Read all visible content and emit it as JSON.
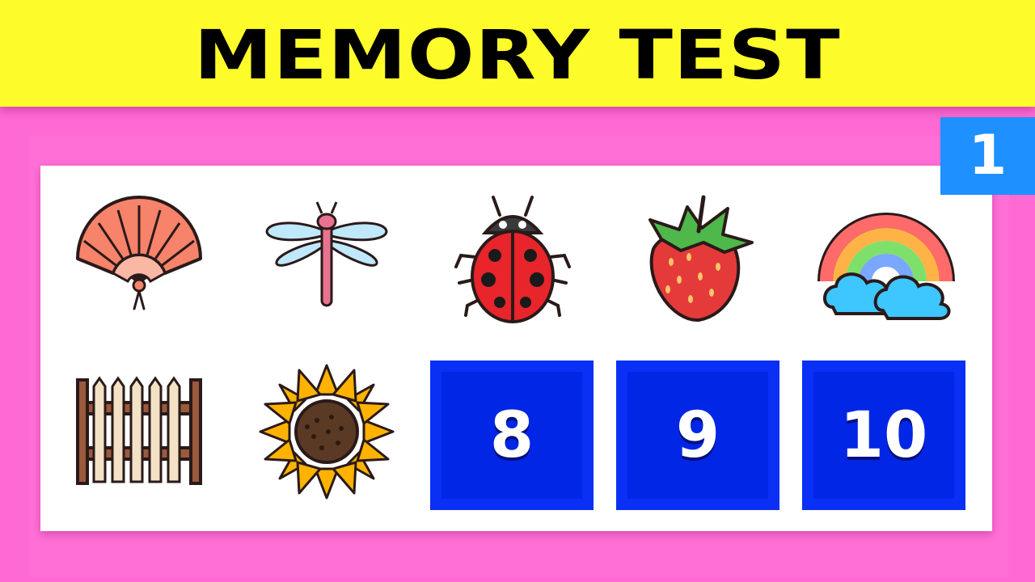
{
  "banner": {
    "title": "MEMORY TEST"
  },
  "level": {
    "number": "1"
  },
  "colors": {
    "background": "#ff69d4",
    "banner": "#fdfb2a",
    "tile": "#0a2ff5",
    "badge": "#1e90ff"
  },
  "cards": [
    {
      "position": 1,
      "icon": "hand-fan-icon"
    },
    {
      "position": 2,
      "icon": "dragonfly-icon"
    },
    {
      "position": 3,
      "icon": "ladybug-icon"
    },
    {
      "position": 4,
      "icon": "strawberry-icon"
    },
    {
      "position": 5,
      "icon": "rainbow-cloud-icon"
    },
    {
      "position": 6,
      "icon": "fence-icon"
    },
    {
      "position": 7,
      "icon": "sunflower-icon"
    }
  ],
  "tiles": [
    {
      "label": "8"
    },
    {
      "label": "9"
    },
    {
      "label": "10"
    }
  ]
}
